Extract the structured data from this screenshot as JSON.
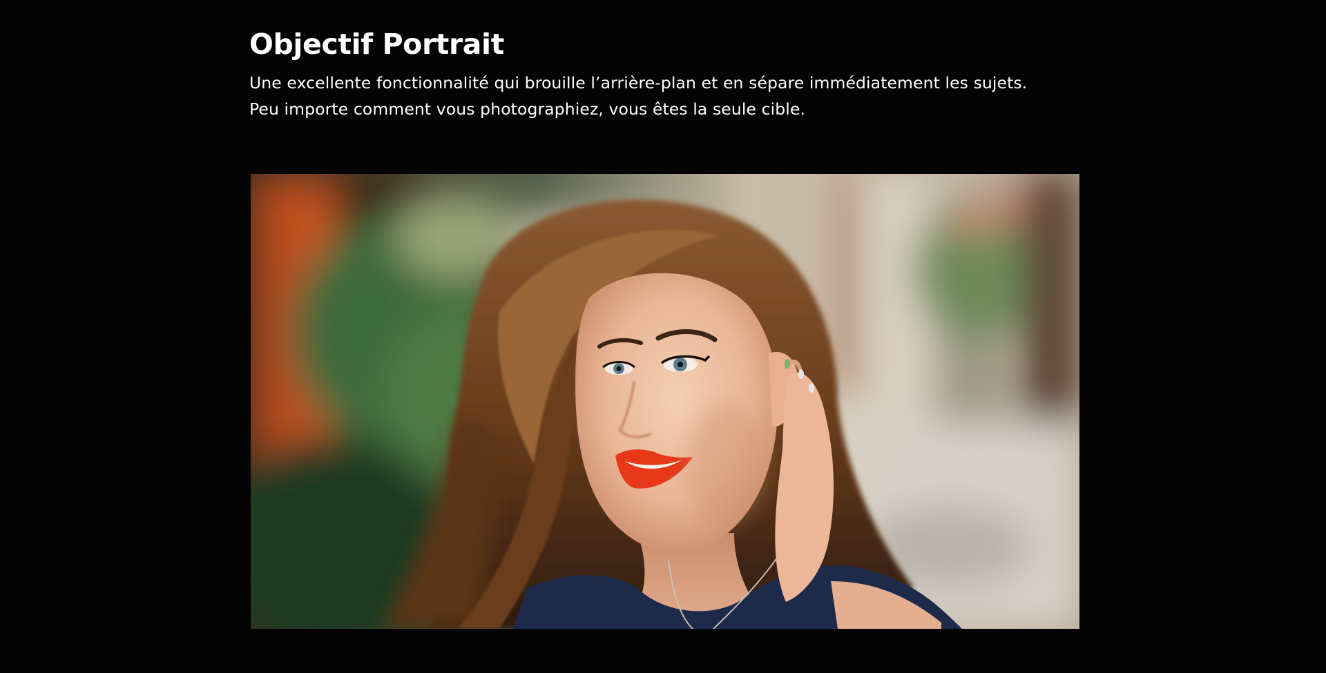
{
  "section": {
    "title": "Objectif Portrait",
    "description_lines": [
      "Une excellente fonctionnalité qui brouille l’arrière-plan et en sépare immédiatement les sujets.",
      "Peu importe comment vous photographiez, vous êtes la seule cible."
    ]
  },
  "photo": {
    "subject": "portrait-photo"
  },
  "colors": {
    "background": "#030303",
    "text": "#ffffff",
    "lips": "#e8381a",
    "hair": "#6b3d1c",
    "top": "#1d2a4a"
  }
}
